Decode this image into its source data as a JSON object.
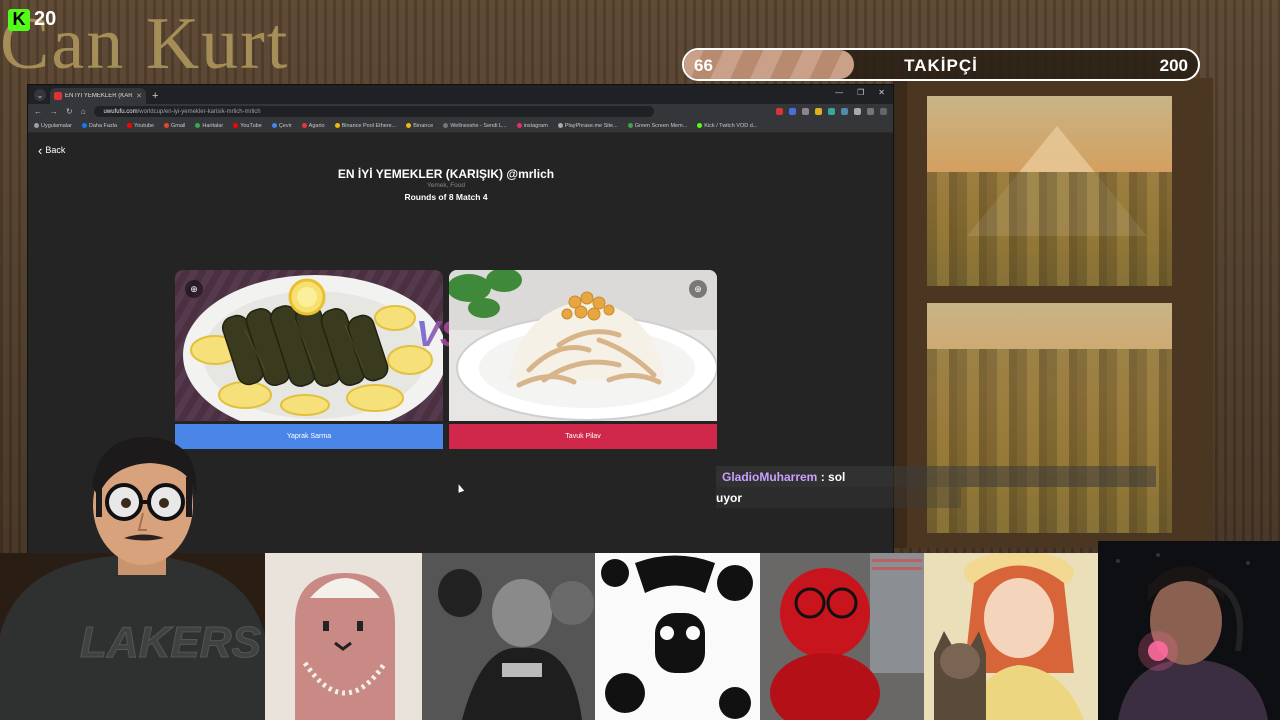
{
  "overlay": {
    "brand_text": "Can Kurt",
    "kick_count": "20",
    "goal": {
      "current": "66",
      "label": "TAKİPÇİ",
      "target": "200",
      "progress_fraction": 0.33
    }
  },
  "browser": {
    "tab_title": "EN İYİ YEMEKLER (KARIŞIK) @m...",
    "url_host": "uwufufu.com",
    "url_path": "/worldcup/en-iyi-yemekler-karisik-mrlich-mrlich",
    "bookmarks": [
      {
        "label": "Uygulamalar",
        "color": "#9aa0a6"
      },
      {
        "label": "Daha Fazla",
        "color": "#1877f2"
      },
      {
        "label": "Youtube",
        "color": "#ff0000"
      },
      {
        "label": "Gmail",
        "color": "#ea4335"
      },
      {
        "label": "Haritalar",
        "color": "#34a853"
      },
      {
        "label": "YouTube",
        "color": "#ff0000"
      },
      {
        "label": "Çevir",
        "color": "#4285f4"
      },
      {
        "label": "Agario",
        "color": "#e53935"
      },
      {
        "label": "Binance Pool Ethere...",
        "color": "#f0b90b"
      },
      {
        "label": "Binance",
        "color": "#f0b90b"
      },
      {
        "label": "Wellnesshe - Sendi L...",
        "color": "#777777"
      },
      {
        "label": "instagram",
        "color": "#e1306c"
      },
      {
        "label": "PlayPhrase.me Site...",
        "color": "#aaaaaa"
      },
      {
        "label": "Green Screen Mem...",
        "color": "#43a047"
      },
      {
        "label": "Kick / Twitch VOD d...",
        "color": "#53fc18"
      }
    ]
  },
  "page": {
    "back_label": "Back",
    "title": "EN İYİ YEMEKLER (KARIŞIK) @mrlich",
    "subtitle": "Yemek, Food",
    "rounds": "Rounds of 8 Match 4",
    "vs": "VS",
    "left_choice": {
      "label": "Yaprak Sarma",
      "color": "#4a86e8"
    },
    "right_choice": {
      "label": "Tavuk Pilav",
      "color": "#d0284a"
    }
  },
  "chat": {
    "messages": [
      {
        "user": "GladioMuharrem",
        "sep": " : ",
        "text": "sol"
      },
      {
        "user": "",
        "sep": "",
        "text": "uyor"
      }
    ]
  }
}
